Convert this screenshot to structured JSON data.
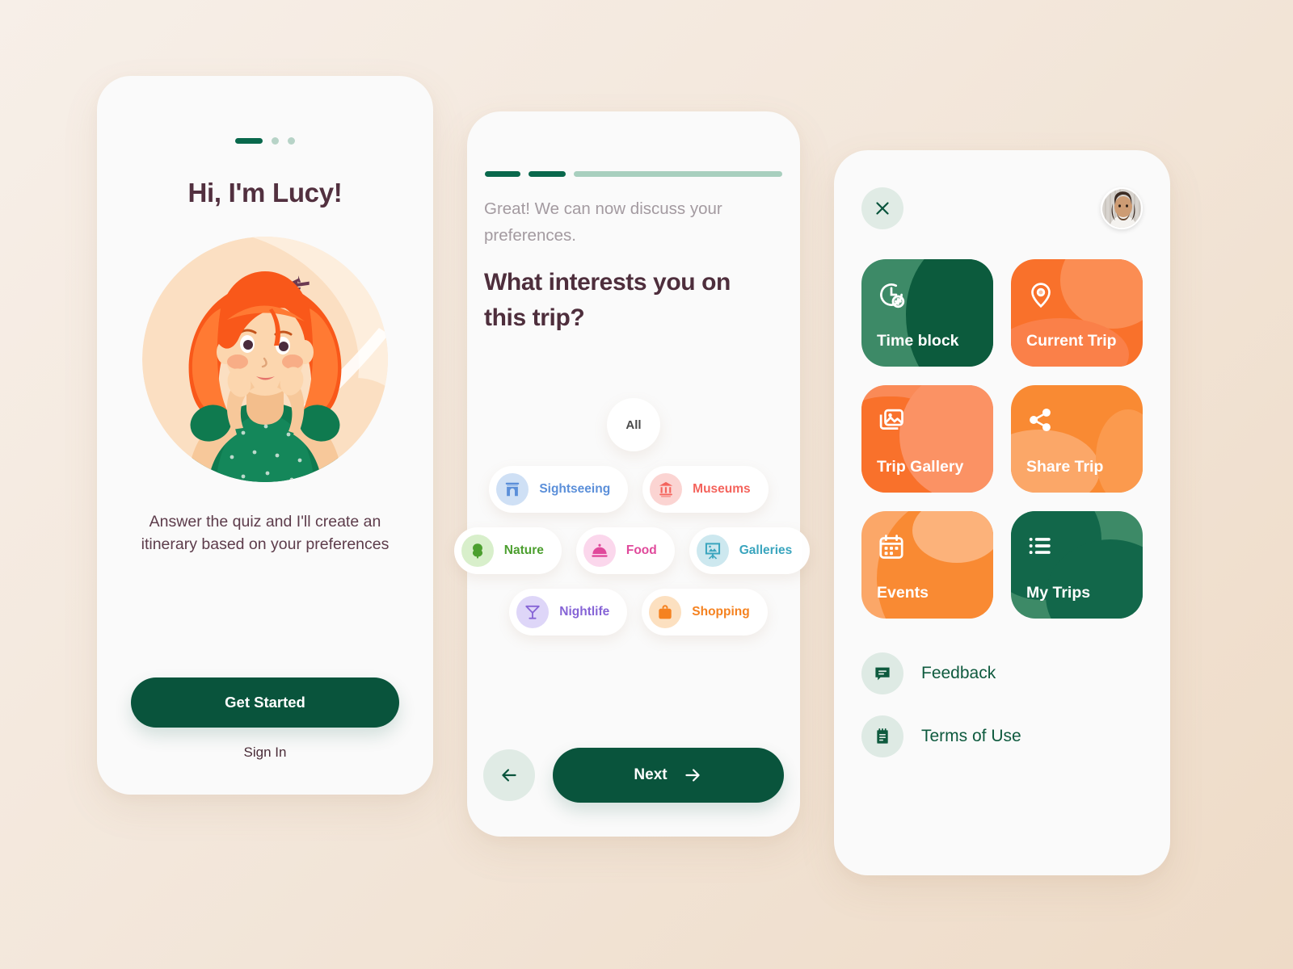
{
  "theme": {
    "bg_start": "#F7EFE8",
    "bg_end": "#EEDBC7",
    "card_bg": "#FAFAFA",
    "green_dark": "#09543C",
    "green_mid": "#3D8A67",
    "green_accent": "#09684C",
    "orange": "#F9712B",
    "orange_light": "#F9A35E",
    "plum": "#52303F"
  },
  "onboarding": {
    "progress": {
      "active_index": 0,
      "total": 3
    },
    "title": "Hi, I'm Lucy!",
    "subtitle": "Answer the quiz and I'll create an itinerary based on your preferences",
    "primary_button": "Get Started",
    "secondary_link": "Sign In",
    "illustration_alt": "woman-traveler-illustration"
  },
  "quiz": {
    "progress": {
      "completed": 2,
      "total": 3
    },
    "lead": "Great! We can now discuss your preferences.",
    "question": "What interests you on this trip?",
    "all_chip": "All",
    "interests": [
      {
        "label": "Sightseeing",
        "icon": "arch-icon",
        "color": "#5B8FD9",
        "bubble": "#CFE0F5"
      },
      {
        "label": "Museums",
        "icon": "museum-icon",
        "color": "#F4635C",
        "bubble": "#FBD4D2"
      },
      {
        "label": "Nature",
        "icon": "tree-icon",
        "color": "#4C9F2F",
        "bubble": "#D8EFCB"
      },
      {
        "label": "Food",
        "icon": "cloche-icon",
        "color": "#E0499B",
        "bubble": "#FBD7EC"
      },
      {
        "label": "Galleries",
        "icon": "easel-icon",
        "color": "#3AA5BE",
        "bubble": "#CDE8EF"
      },
      {
        "label": "Nightlife",
        "icon": "cocktail-icon",
        "color": "#8664D6",
        "bubble": "#DED6F8"
      },
      {
        "label": "Shopping",
        "icon": "bag-icon",
        "color": "#F58220",
        "bubble": "#FCE0C0"
      }
    ],
    "back_button": "back-arrow",
    "next_button": "Next"
  },
  "menu": {
    "close_button": "close-icon",
    "avatar": "user-avatar",
    "tiles": [
      {
        "label": "Time block",
        "icon": "clock-plus-icon",
        "base": "#3D8A67",
        "blob": "#0C5B3D"
      },
      {
        "label": "Current Trip",
        "icon": "map-pin-icon",
        "base": "#F9712B",
        "blob": "#FB8D53"
      },
      {
        "label": "Trip Gallery",
        "icon": "gallery-icon",
        "base": "#FA8A57",
        "blob": "#F9712B"
      },
      {
        "label": "Share Trip",
        "icon": "share-icon",
        "base": "#F98A33",
        "blob": "#FBA768"
      },
      {
        "label": "Events",
        "icon": "calendar-icon",
        "base": "#FBA768",
        "blob": "#F98A33"
      },
      {
        "label": "My Trips",
        "icon": "list-icon",
        "base": "#3D8A67",
        "blob": "#12674A"
      }
    ],
    "links": [
      {
        "label": "Feedback",
        "icon": "chat-icon"
      },
      {
        "label": "Terms of Use",
        "icon": "notepad-icon"
      }
    ]
  }
}
